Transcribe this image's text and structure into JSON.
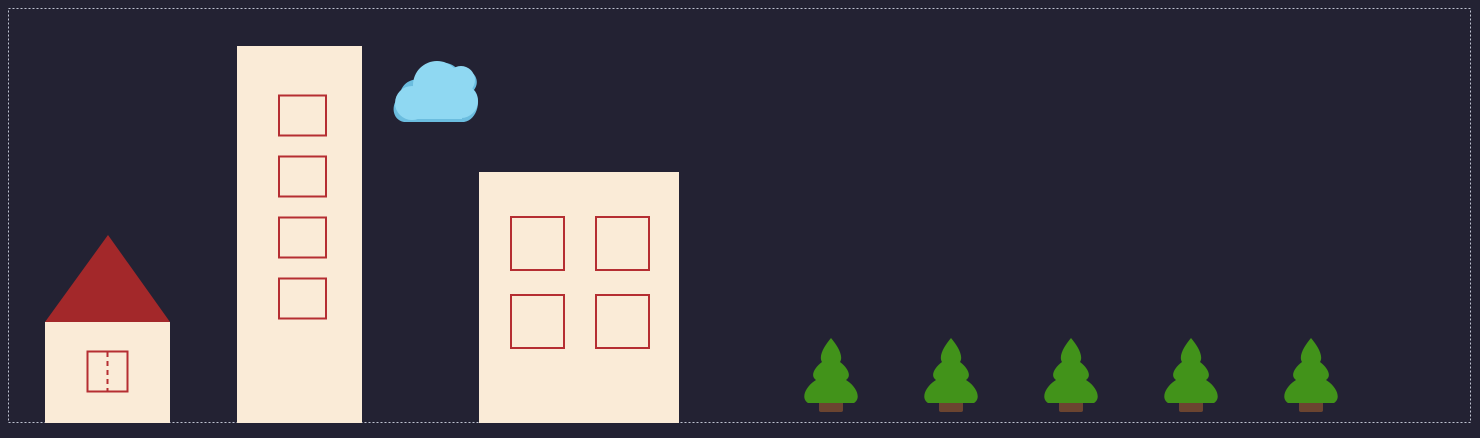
{
  "colors": {
    "background": "#232233",
    "frame": "#bfc3d2",
    "wall": "#faebd7",
    "roof": "#a3282a",
    "trim": "#b52e32",
    "cloud": "#8fd8f2",
    "cloud_shadow": "#6bbddf",
    "tree_green": "#42931a",
    "tree_trunk": "#6b4430"
  },
  "scene": {
    "house": {
      "windows": 1
    },
    "tower": {
      "windows": 4
    },
    "block_building": {
      "windows": 4
    },
    "cloud": {
      "count": 1
    },
    "trees": {
      "count": 5
    }
  }
}
